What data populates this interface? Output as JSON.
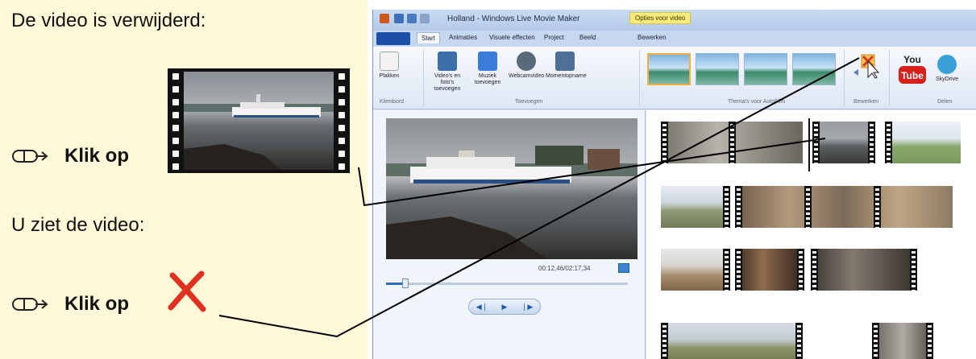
{
  "instructions": {
    "deleted_text": "De video is verwijderd:",
    "step1_label": "Klik op",
    "step2_text": "U ziet de video:",
    "step3_label": "Klik op"
  },
  "window": {
    "title": "Holland - Windows Live Movie Maker",
    "contextual_tab": "Opties voor video"
  },
  "tabs": [
    "Start",
    "Animaties",
    "Visuele effecten",
    "Project",
    "Beeld",
    "Bewerken"
  ],
  "ribbon": {
    "paste_label": "Plakken",
    "clipboard_group": "Klembord",
    "add_video_label": "Video's en foto's toevoegen",
    "add_music_label": "Muziek toevoegen",
    "webcam_label": "Webcamvideo",
    "snapshot_label": "Momentopname",
    "insert_group": "Toevoegen",
    "themes_group": "Thema's voor AutoFilm",
    "edit_group": "Bewerken",
    "share_group": "Delen",
    "skydrive_label": "SkyDrive",
    "youtube_label": "You Tube"
  },
  "preview": {
    "timecode": "00:12,46/02:17,34",
    "seek_progress": 0.08
  },
  "colors": {
    "instruction_bg": "#fff8d8",
    "delete_red": "#e03020",
    "callout_line": "#000000"
  }
}
